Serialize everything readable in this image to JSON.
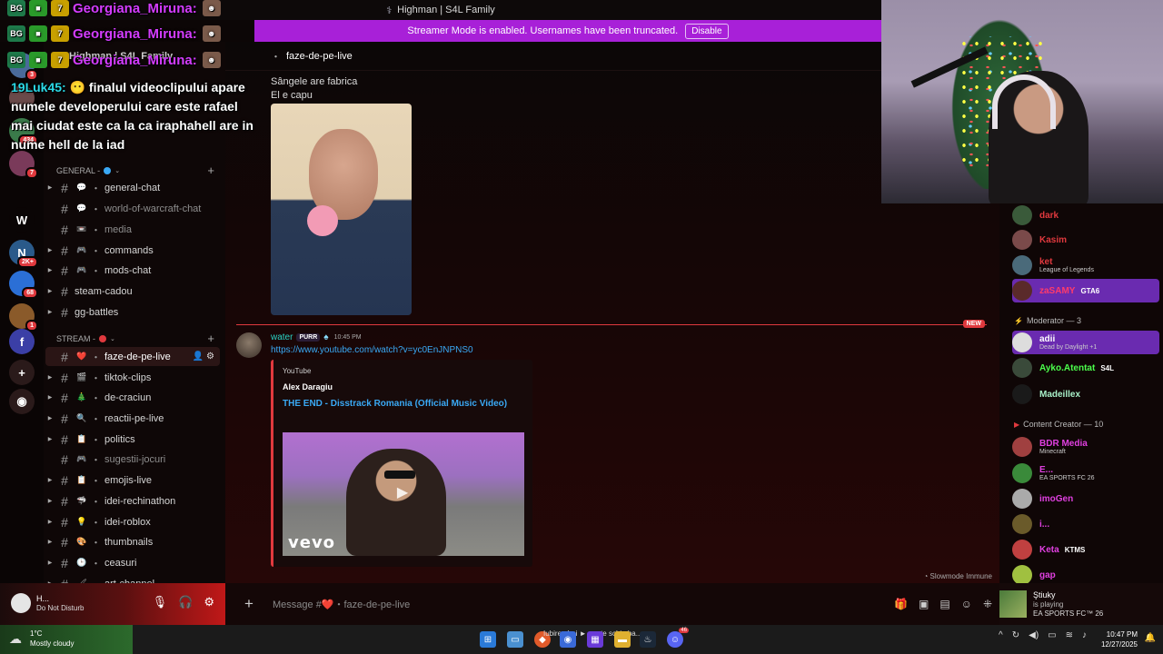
{
  "window": {
    "title": "Highman | S4L Family"
  },
  "banner": {
    "text": "Streamer Mode is enabled. Usernames have been truncated.",
    "button_label": "Disable"
  },
  "overlay": {
    "repeat_name": "Georgiana_Miruna:",
    "chat_user": "19Luk45:",
    "chat_message": " finalul videoclipului apare numele developerului care este rafael mai ciudat este ca la ca iraphahell are in nume hell de la iad"
  },
  "servers": [
    {
      "label": "",
      "badge": "3",
      "color": "#4a6a9a"
    },
    {
      "label": "",
      "badge": "",
      "color": "#6a4a4a"
    },
    {
      "label": "",
      "badge": "434",
      "color": "#3a7a4a"
    },
    {
      "label": "",
      "badge": "7",
      "color": "#7a3a5a"
    },
    {
      "label": "W",
      "badge": "",
      "color": "#0a0505"
    },
    {
      "label": "N",
      "badge": "2K+",
      "color": "#2a5a8a"
    },
    {
      "label": "",
      "badge": "68",
      "color": "#2b6fd6"
    },
    {
      "label": "",
      "badge": "1",
      "color": "#8a5a2a"
    },
    {
      "label": "f",
      "badge": "",
      "color": "#3b3fa6"
    },
    {
      "label": "+",
      "badge": "",
      "color": "#2a1a1a"
    },
    {
      "label": "◉",
      "badge": "",
      "color": "#2a1a1a"
    }
  ],
  "sidebar": {
    "server_name": "Highman | S4L Family",
    "categories": [
      {
        "label": "GENERAL -",
        "dot_color": "#3aa9f5"
      },
      {
        "label": "STREAM -",
        "dot_color": "#e0393e"
      }
    ],
    "channels": [
      {
        "label": "general-chat",
        "emoji": "💬",
        "sep": "・",
        "active": false,
        "muted": false,
        "expand": true
      },
      {
        "label": "world-of-warcraft-chat",
        "emoji": "💬",
        "sep": "・",
        "active": false,
        "muted": true,
        "expand": false
      },
      {
        "label": "media",
        "emoji": "📼",
        "sep": "・",
        "active": false,
        "muted": true,
        "expand": false
      },
      {
        "label": "commands",
        "emoji": "🎮",
        "sep": "・",
        "active": false,
        "muted": false,
        "expand": true
      },
      {
        "label": "mods-chat",
        "emoji": "🎮",
        "sep": "・",
        "active": false,
        "muted": false,
        "expand": true
      },
      {
        "label": "steam-cadou",
        "emoji": "",
        "sep": "",
        "active": false,
        "muted": false,
        "expand": true
      },
      {
        "label": "gg-battles",
        "emoji": "",
        "sep": "",
        "active": false,
        "muted": false,
        "expand": true
      },
      {
        "label": "faze-de-pe-live",
        "emoji": "❤️",
        "sep": "・",
        "active": true,
        "muted": false,
        "expand": false
      },
      {
        "label": "tiktok-clips",
        "emoji": "🎬",
        "sep": "・",
        "active": false,
        "muted": false,
        "expand": true
      },
      {
        "label": "de-craciun",
        "emoji": "🎄",
        "sep": "・",
        "active": false,
        "muted": false,
        "expand": true
      },
      {
        "label": "reactii-pe-live",
        "emoji": "🔍",
        "sep": "・",
        "active": false,
        "muted": false,
        "expand": true
      },
      {
        "label": "politics",
        "emoji": "📋",
        "sep": "・",
        "active": false,
        "muted": false,
        "expand": true
      },
      {
        "label": "sugestii-jocuri",
        "emoji": "🎮",
        "sep": "・",
        "active": false,
        "muted": true,
        "expand": false
      },
      {
        "label": "emojis-live",
        "emoji": "📋",
        "sep": "・",
        "active": false,
        "muted": false,
        "expand": true
      },
      {
        "label": "idei-rechinathon",
        "emoji": "🦈",
        "sep": "・",
        "active": false,
        "muted": false,
        "expand": true
      },
      {
        "label": "idei-roblox",
        "emoji": "💡",
        "sep": "・",
        "active": false,
        "muted": false,
        "expand": true
      },
      {
        "label": "thumbnails",
        "emoji": "🎨",
        "sep": "・",
        "active": false,
        "muted": false,
        "expand": true
      },
      {
        "label": "ceasuri",
        "emoji": "🕒",
        "sep": "・",
        "active": false,
        "muted": false,
        "expand": true
      },
      {
        "label": "art-channel",
        "emoji": "🖌",
        "sep": "・",
        "active": false,
        "muted": false,
        "expand": true
      }
    ]
  },
  "channel": {
    "name": "faze-de-pe-live",
    "sep": "・"
  },
  "messages": {
    "prev_line1": "Sângele are fabrica",
    "prev_line2": "El e capu",
    "author": "water",
    "tag": "PURR",
    "time": "10:45 PM",
    "link": "https://www.youtube.com/watch?v=yc0EnJNPNS0",
    "embed_provider": "YouTube",
    "embed_author": "Alex Daragiu",
    "embed_title": "THE END - Disstrack Romania (Official Music Video)",
    "embed_brand": "vevo",
    "new_label": "NEW",
    "slowmode": "Slowmode Immune"
  },
  "input": {
    "placeholder": "Message #❤️・faze-de-pe-live"
  },
  "user": {
    "name": "H...",
    "status": "Do Not Disturb"
  },
  "members": {
    "top": [
      {
        "name": "dark",
        "color": "#e0393e",
        "activity": "",
        "extra": "",
        "highlight": false,
        "avatar": "#3a5a3a"
      },
      {
        "name": "Kasim",
        "color": "#e0393e",
        "activity": "",
        "extra": "",
        "highlight": false,
        "avatar": "#7a4a4a"
      },
      {
        "name": "ket",
        "color": "#e0393e",
        "activity": "League of Legends",
        "extra": "",
        "highlight": false,
        "avatar": "#4a6a7a"
      },
      {
        "name": "zaSAMY",
        "color": "#ff3b6b",
        "activity": "",
        "extra": "GTA6",
        "highlight": true,
        "avatar": "#5a2a2a"
      }
    ],
    "moderator_label": "Moderator — 3",
    "moderators": [
      {
        "name": "adii",
        "color": "#ffffff",
        "activity": "Dead by Daylight +1",
        "extra": "",
        "highlight": true,
        "avatar": "#dddddd"
      },
      {
        "name": "Ayko.Atentat",
        "color": "#4cff4c",
        "activity": "",
        "extra": "S4L",
        "highlight": false,
        "avatar": "#3a4a3a"
      },
      {
        "name": "Madeillex",
        "color": "#a8f0c8",
        "activity": "",
        "extra": "",
        "highlight": false,
        "avatar": "#1a1a1a"
      }
    ],
    "creator_label": "Content Creator — 10",
    "creators": [
      {
        "name": "BDR Media",
        "color": "#e040e0",
        "activity": "Minecraft",
        "extra": "",
        "avatar": "#a04040"
      },
      {
        "name": "E...",
        "color": "#e040e0",
        "activity": "EA SPORTS FC 26",
        "extra": "",
        "avatar": "#3a8a3a"
      },
      {
        "name": "imoGen",
        "color": "#e040e0",
        "activity": "",
        "extra": "",
        "avatar": "#aaaaaa"
      },
      {
        "name": "i...",
        "color": "#e040e0",
        "activity": "",
        "extra": "",
        "avatar": "#6a5a2a"
      },
      {
        "name": "Keta",
        "color": "#e040e0",
        "activity": "",
        "extra": "KTMS",
        "avatar": "#c04040"
      },
      {
        "name": "gap",
        "color": "#e040e0",
        "activity": "",
        "extra": "",
        "avatar": "#a0c040"
      }
    ]
  },
  "now_playing": {
    "name": "Ştiuky",
    "status": "is playing",
    "game": "EA SPORTS FC™ 26"
  },
  "taskbar": {
    "temp": "1°C",
    "condition": "Mostly cloudy",
    "media_text": "Iubirea Lui ► poate schimba...",
    "time": "10:47 PM",
    "date": "12/27/2025",
    "badge_count": "46"
  }
}
